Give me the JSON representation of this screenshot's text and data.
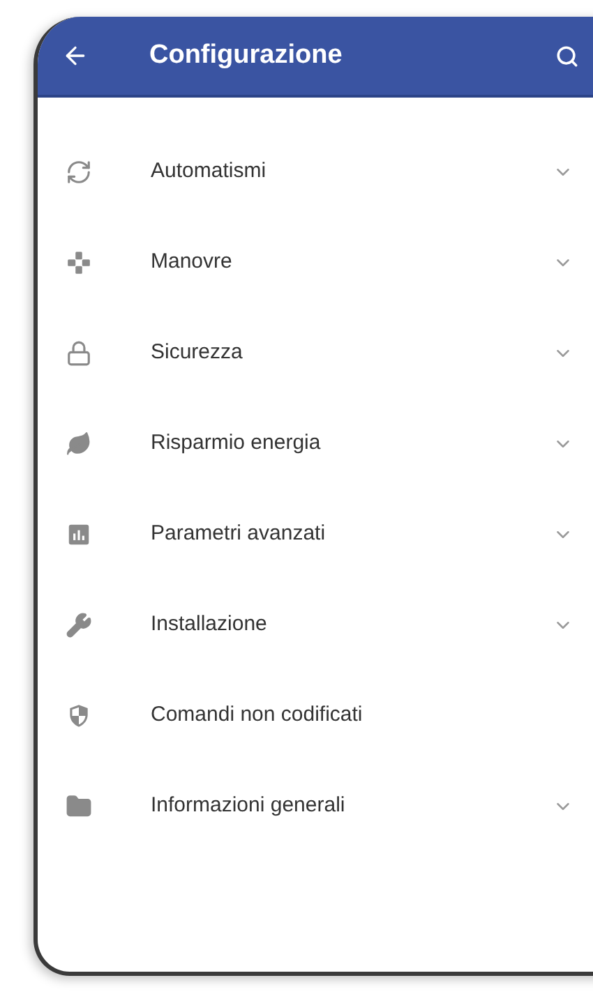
{
  "header": {
    "title": "Configurazione"
  },
  "items": [
    {
      "label": "Automatismi",
      "expandable": true
    },
    {
      "label": "Manovre",
      "expandable": true
    },
    {
      "label": "Sicurezza",
      "expandable": true
    },
    {
      "label": "Risparmio energia",
      "expandable": true
    },
    {
      "label": "Parametri avanzati",
      "expandable": true
    },
    {
      "label": "Installazione",
      "expandable": true
    },
    {
      "label": "Comandi non codificati",
      "expandable": false
    },
    {
      "label": "Informazioni generali",
      "expandable": true
    }
  ]
}
